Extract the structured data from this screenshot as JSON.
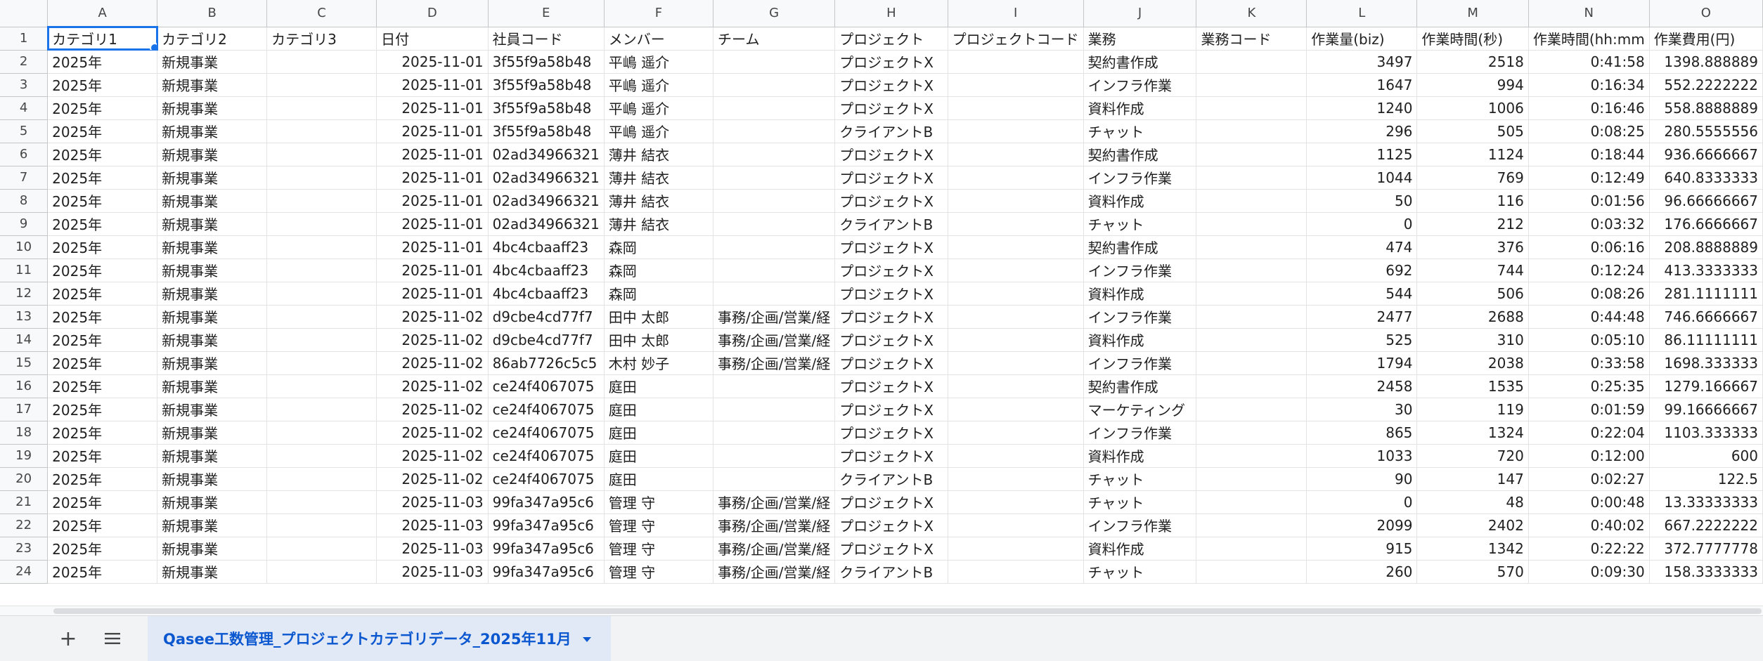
{
  "column_letters": [
    "A",
    "B",
    "C",
    "D",
    "E",
    "F",
    "G",
    "H",
    "I",
    "J",
    "K",
    "L",
    "M",
    "N",
    "O"
  ],
  "numeric_columns": [
    3,
    11,
    12,
    13,
    14
  ],
  "selected_cell": "A1",
  "header_row": [
    "カテゴリ1",
    "カテゴリ2",
    "カテゴリ3",
    "日付",
    "社員コード",
    "メンバー",
    "チーム",
    "プロジェクト",
    "プロジェクトコード",
    "業務",
    "業務コード",
    "作業量(biz)",
    "作業時間(秒)",
    "作業時間(hh:mm",
    "作業費用(円)"
  ],
  "rows": [
    [
      "2025年",
      "新規事業",
      "",
      "2025-11-01",
      "3f55f9a58b48",
      "平嶋 遥介",
      "",
      "プロジェクトX",
      "",
      "契約書作成",
      "",
      "3497",
      "2518",
      "0:41:58",
      "1398.888889"
    ],
    [
      "2025年",
      "新規事業",
      "",
      "2025-11-01",
      "3f55f9a58b48",
      "平嶋 遥介",
      "",
      "プロジェクトX",
      "",
      "インフラ作業",
      "",
      "1647",
      "994",
      "0:16:34",
      "552.2222222"
    ],
    [
      "2025年",
      "新規事業",
      "",
      "2025-11-01",
      "3f55f9a58b48",
      "平嶋 遥介",
      "",
      "プロジェクトX",
      "",
      "資料作成",
      "",
      "1240",
      "1006",
      "0:16:46",
      "558.8888889"
    ],
    [
      "2025年",
      "新規事業",
      "",
      "2025-11-01",
      "3f55f9a58b48",
      "平嶋 遥介",
      "",
      "クライアントB",
      "",
      "チャット",
      "",
      "296",
      "505",
      "0:08:25",
      "280.5555556"
    ],
    [
      "2025年",
      "新規事業",
      "",
      "2025-11-01",
      "02ad34966321",
      "薄井 結衣",
      "",
      "プロジェクトX",
      "",
      "契約書作成",
      "",
      "1125",
      "1124",
      "0:18:44",
      "936.6666667"
    ],
    [
      "2025年",
      "新規事業",
      "",
      "2025-11-01",
      "02ad34966321",
      "薄井 結衣",
      "",
      "プロジェクトX",
      "",
      "インフラ作業",
      "",
      "1044",
      "769",
      "0:12:49",
      "640.8333333"
    ],
    [
      "2025年",
      "新規事業",
      "",
      "2025-11-01",
      "02ad34966321",
      "薄井 結衣",
      "",
      "プロジェクトX",
      "",
      "資料作成",
      "",
      "50",
      "116",
      "0:01:56",
      "96.66666667"
    ],
    [
      "2025年",
      "新規事業",
      "",
      "2025-11-01",
      "02ad34966321",
      "薄井 結衣",
      "",
      "クライアントB",
      "",
      "チャット",
      "",
      "0",
      "212",
      "0:03:32",
      "176.6666667"
    ],
    [
      "2025年",
      "新規事業",
      "",
      "2025-11-01",
      "4bc4cbaaff23",
      "森岡",
      "",
      "プロジェクトX",
      "",
      "契約書作成",
      "",
      "474",
      "376",
      "0:06:16",
      "208.8888889"
    ],
    [
      "2025年",
      "新規事業",
      "",
      "2025-11-01",
      "4bc4cbaaff23",
      "森岡",
      "",
      "プロジェクトX",
      "",
      "インフラ作業",
      "",
      "692",
      "744",
      "0:12:24",
      "413.3333333"
    ],
    [
      "2025年",
      "新規事業",
      "",
      "2025-11-01",
      "4bc4cbaaff23",
      "森岡",
      "",
      "プロジェクトX",
      "",
      "資料作成",
      "",
      "544",
      "506",
      "0:08:26",
      "281.1111111"
    ],
    [
      "2025年",
      "新規事業",
      "",
      "2025-11-02",
      "d9cbe4cd77f7",
      "田中 太郎",
      "事務/企画/営業/経",
      "プロジェクトX",
      "",
      "インフラ作業",
      "",
      "2477",
      "2688",
      "0:44:48",
      "746.6666667"
    ],
    [
      "2025年",
      "新規事業",
      "",
      "2025-11-02",
      "d9cbe4cd77f7",
      "田中 太郎",
      "事務/企画/営業/経",
      "プロジェクトX",
      "",
      "資料作成",
      "",
      "525",
      "310",
      "0:05:10",
      "86.11111111"
    ],
    [
      "2025年",
      "新規事業",
      "",
      "2025-11-02",
      "86ab7726c5c5",
      "木村 妙子",
      "事務/企画/営業/経",
      "プロジェクトX",
      "",
      "インフラ作業",
      "",
      "1794",
      "2038",
      "0:33:58",
      "1698.333333"
    ],
    [
      "2025年",
      "新規事業",
      "",
      "2025-11-02",
      "ce24f4067075",
      "庭田",
      "",
      "プロジェクトX",
      "",
      "契約書作成",
      "",
      "2458",
      "1535",
      "0:25:35",
      "1279.166667"
    ],
    [
      "2025年",
      "新規事業",
      "",
      "2025-11-02",
      "ce24f4067075",
      "庭田",
      "",
      "プロジェクトX",
      "",
      "マーケティング",
      "",
      "30",
      "119",
      "0:01:59",
      "99.16666667"
    ],
    [
      "2025年",
      "新規事業",
      "",
      "2025-11-02",
      "ce24f4067075",
      "庭田",
      "",
      "プロジェクトX",
      "",
      "インフラ作業",
      "",
      "865",
      "1324",
      "0:22:04",
      "1103.333333"
    ],
    [
      "2025年",
      "新規事業",
      "",
      "2025-11-02",
      "ce24f4067075",
      "庭田",
      "",
      "プロジェクトX",
      "",
      "資料作成",
      "",
      "1033",
      "720",
      "0:12:00",
      "600"
    ],
    [
      "2025年",
      "新規事業",
      "",
      "2025-11-02",
      "ce24f4067075",
      "庭田",
      "",
      "クライアントB",
      "",
      "チャット",
      "",
      "90",
      "147",
      "0:02:27",
      "122.5"
    ],
    [
      "2025年",
      "新規事業",
      "",
      "2025-11-03",
      "99fa347a95c6",
      "管理 守",
      "事務/企画/営業/経",
      "プロジェクトX",
      "",
      "チャット",
      "",
      "0",
      "48",
      "0:00:48",
      "13.33333333"
    ],
    [
      "2025年",
      "新規事業",
      "",
      "2025-11-03",
      "99fa347a95c6",
      "管理 守",
      "事務/企画/営業/経",
      "プロジェクトX",
      "",
      "インフラ作業",
      "",
      "2099",
      "2402",
      "0:40:02",
      "667.2222222"
    ],
    [
      "2025年",
      "新規事業",
      "",
      "2025-11-03",
      "99fa347a95c6",
      "管理 守",
      "事務/企画/営業/経",
      "プロジェクトX",
      "",
      "資料作成",
      "",
      "915",
      "1342",
      "0:22:22",
      "372.7777778"
    ],
    [
      "2025年",
      "新規事業",
      "",
      "2025-11-03",
      "99fa347a95c6",
      "管理 守",
      "事務/企画/営業/経",
      "クライアントB",
      "",
      "チャット",
      "",
      "260",
      "570",
      "0:09:30",
      "158.3333333"
    ]
  ],
  "sheet_bar": {
    "add_icon": "plus-icon",
    "all_sheets_icon": "menu-icon",
    "tab_label": "Qasee工数管理_プロジェクトカテゴリデータ_2025年11月",
    "tab_caret_icon": "caret-down-icon",
    "accent_color": "#0b57d0"
  }
}
